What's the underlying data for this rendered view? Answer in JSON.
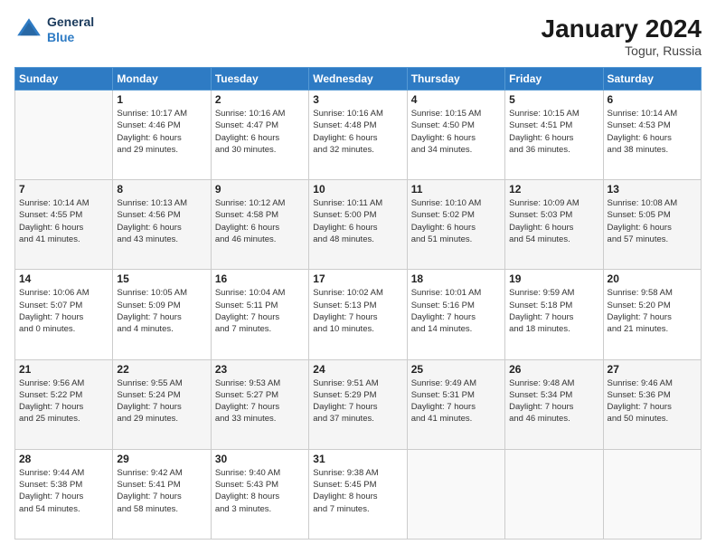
{
  "logo": {
    "line1": "General",
    "line2": "Blue"
  },
  "title": "January 2024",
  "subtitle": "Togur, Russia",
  "days_header": [
    "Sunday",
    "Monday",
    "Tuesday",
    "Wednesday",
    "Thursday",
    "Friday",
    "Saturday"
  ],
  "weeks": [
    [
      {
        "num": "",
        "info": ""
      },
      {
        "num": "1",
        "info": "Sunrise: 10:17 AM\nSunset: 4:46 PM\nDaylight: 6 hours\nand 29 minutes."
      },
      {
        "num": "2",
        "info": "Sunrise: 10:16 AM\nSunset: 4:47 PM\nDaylight: 6 hours\nand 30 minutes."
      },
      {
        "num": "3",
        "info": "Sunrise: 10:16 AM\nSunset: 4:48 PM\nDaylight: 6 hours\nand 32 minutes."
      },
      {
        "num": "4",
        "info": "Sunrise: 10:15 AM\nSunset: 4:50 PM\nDaylight: 6 hours\nand 34 minutes."
      },
      {
        "num": "5",
        "info": "Sunrise: 10:15 AM\nSunset: 4:51 PM\nDaylight: 6 hours\nand 36 minutes."
      },
      {
        "num": "6",
        "info": "Sunrise: 10:14 AM\nSunset: 4:53 PM\nDaylight: 6 hours\nand 38 minutes."
      }
    ],
    [
      {
        "num": "7",
        "info": "Sunrise: 10:14 AM\nSunset: 4:55 PM\nDaylight: 6 hours\nand 41 minutes."
      },
      {
        "num": "8",
        "info": "Sunrise: 10:13 AM\nSunset: 4:56 PM\nDaylight: 6 hours\nand 43 minutes."
      },
      {
        "num": "9",
        "info": "Sunrise: 10:12 AM\nSunset: 4:58 PM\nDaylight: 6 hours\nand 46 minutes."
      },
      {
        "num": "10",
        "info": "Sunrise: 10:11 AM\nSunset: 5:00 PM\nDaylight: 6 hours\nand 48 minutes."
      },
      {
        "num": "11",
        "info": "Sunrise: 10:10 AM\nSunset: 5:02 PM\nDaylight: 6 hours\nand 51 minutes."
      },
      {
        "num": "12",
        "info": "Sunrise: 10:09 AM\nSunset: 5:03 PM\nDaylight: 6 hours\nand 54 minutes."
      },
      {
        "num": "13",
        "info": "Sunrise: 10:08 AM\nSunset: 5:05 PM\nDaylight: 6 hours\nand 57 minutes."
      }
    ],
    [
      {
        "num": "14",
        "info": "Sunrise: 10:06 AM\nSunset: 5:07 PM\nDaylight: 7 hours\nand 0 minutes."
      },
      {
        "num": "15",
        "info": "Sunrise: 10:05 AM\nSunset: 5:09 PM\nDaylight: 7 hours\nand 4 minutes."
      },
      {
        "num": "16",
        "info": "Sunrise: 10:04 AM\nSunset: 5:11 PM\nDaylight: 7 hours\nand 7 minutes."
      },
      {
        "num": "17",
        "info": "Sunrise: 10:02 AM\nSunset: 5:13 PM\nDaylight: 7 hours\nand 10 minutes."
      },
      {
        "num": "18",
        "info": "Sunrise: 10:01 AM\nSunset: 5:16 PM\nDaylight: 7 hours\nand 14 minutes."
      },
      {
        "num": "19",
        "info": "Sunrise: 9:59 AM\nSunset: 5:18 PM\nDaylight: 7 hours\nand 18 minutes."
      },
      {
        "num": "20",
        "info": "Sunrise: 9:58 AM\nSunset: 5:20 PM\nDaylight: 7 hours\nand 21 minutes."
      }
    ],
    [
      {
        "num": "21",
        "info": "Sunrise: 9:56 AM\nSunset: 5:22 PM\nDaylight: 7 hours\nand 25 minutes."
      },
      {
        "num": "22",
        "info": "Sunrise: 9:55 AM\nSunset: 5:24 PM\nDaylight: 7 hours\nand 29 minutes."
      },
      {
        "num": "23",
        "info": "Sunrise: 9:53 AM\nSunset: 5:27 PM\nDaylight: 7 hours\nand 33 minutes."
      },
      {
        "num": "24",
        "info": "Sunrise: 9:51 AM\nSunset: 5:29 PM\nDaylight: 7 hours\nand 37 minutes."
      },
      {
        "num": "25",
        "info": "Sunrise: 9:49 AM\nSunset: 5:31 PM\nDaylight: 7 hours\nand 41 minutes."
      },
      {
        "num": "26",
        "info": "Sunrise: 9:48 AM\nSunset: 5:34 PM\nDaylight: 7 hours\nand 46 minutes."
      },
      {
        "num": "27",
        "info": "Sunrise: 9:46 AM\nSunset: 5:36 PM\nDaylight: 7 hours\nand 50 minutes."
      }
    ],
    [
      {
        "num": "28",
        "info": "Sunrise: 9:44 AM\nSunset: 5:38 PM\nDaylight: 7 hours\nand 54 minutes."
      },
      {
        "num": "29",
        "info": "Sunrise: 9:42 AM\nSunset: 5:41 PM\nDaylight: 7 hours\nand 58 minutes."
      },
      {
        "num": "30",
        "info": "Sunrise: 9:40 AM\nSunset: 5:43 PM\nDaylight: 8 hours\nand 3 minutes."
      },
      {
        "num": "31",
        "info": "Sunrise: 9:38 AM\nSunset: 5:45 PM\nDaylight: 8 hours\nand 7 minutes."
      },
      {
        "num": "",
        "info": ""
      },
      {
        "num": "",
        "info": ""
      },
      {
        "num": "",
        "info": ""
      }
    ]
  ]
}
